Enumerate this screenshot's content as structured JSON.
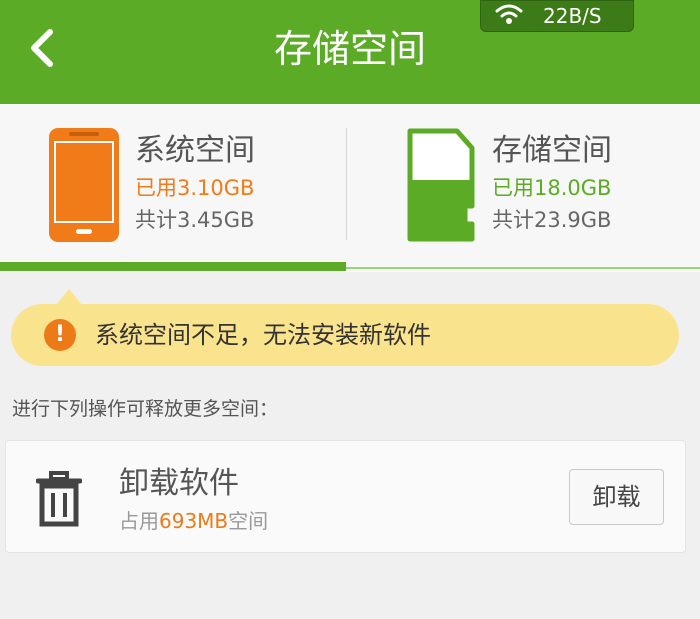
{
  "header": {
    "title": "存储空间",
    "back_icon": "chevron-left-icon"
  },
  "status_bar": {
    "wifi_icon": "wifi-icon",
    "speed": "22B/S"
  },
  "system_storage": {
    "icon": "phone-icon",
    "name": "系统空间",
    "used": "已用3.10GB",
    "total": "共计3.45GB",
    "accent_color": "#f07b18"
  },
  "sd_storage": {
    "icon": "sd-card-icon",
    "name": "存储空间",
    "used": "已用18.0GB",
    "total": "共计23.9GB",
    "accent_color": "#5bab26"
  },
  "warning": {
    "icon": "exclamation-icon",
    "text": "系统空间不足，无法安装新软件"
  },
  "hint": "进行下列操作可释放更多空间：",
  "action": {
    "icon": "trash-icon",
    "name": "卸载软件",
    "sub_prefix": "占用",
    "sub_value": "693MB",
    "sub_suffix": "空间",
    "button_label": "卸载"
  },
  "colors": {
    "brand_green": "#5bab26",
    "warning_bg": "#fae38d",
    "highlight_orange": "#ec7a19"
  }
}
